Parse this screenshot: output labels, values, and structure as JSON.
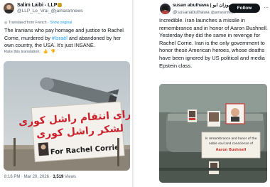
{
  "left_tweet": {
    "author_name": "Salim Laibi - LLP",
    "handle": "@LLP_Le_Vrai_@jamarannews",
    "translated_prefix": "Translated from French",
    "show_original": "Show original",
    "text_parts": [
      "The Iranians who pay homage and justice to Rachel Corrie, murdered by ",
      "#Israël",
      " and abandoned by her own country, the USA. It's just INSANE."
    ],
    "rate_label": "Rate this translation:",
    "banner_persian_line1": "برای انتقام راشل کوری",
    "banner_persian_line2": "لشکر راشل کوری",
    "banner_english": "For Rachel Corrie",
    "timestamp": "8:16 PM · Mar 20, 2026 · ",
    "views_count": "3,519",
    "views_label": " Views"
  },
  "right_tweet": {
    "author_name": "susan abulhawa | سوزان ابو",
    "handle": "@susanabulhawa",
    "handle_extra": "@jamarannews",
    "follow_label": "Follow",
    "text": "Incredible. Iran launches a missile in remembrance and in honor of Aaron Bushnell. Yesterday they did the same in revenge for Rachel Corrie. Iran is the only government to honor these American heroes, whose deaths have been ignored by US political and media Epstein class.",
    "sign_line1": "In remembrance and honor of the",
    "sign_line2": "noble soul and conscience of",
    "sign_name": "Aaron Bushnell"
  },
  "colors": {
    "link": "#1d9bf0",
    "text": "#0f1419",
    "muted": "#536471"
  }
}
